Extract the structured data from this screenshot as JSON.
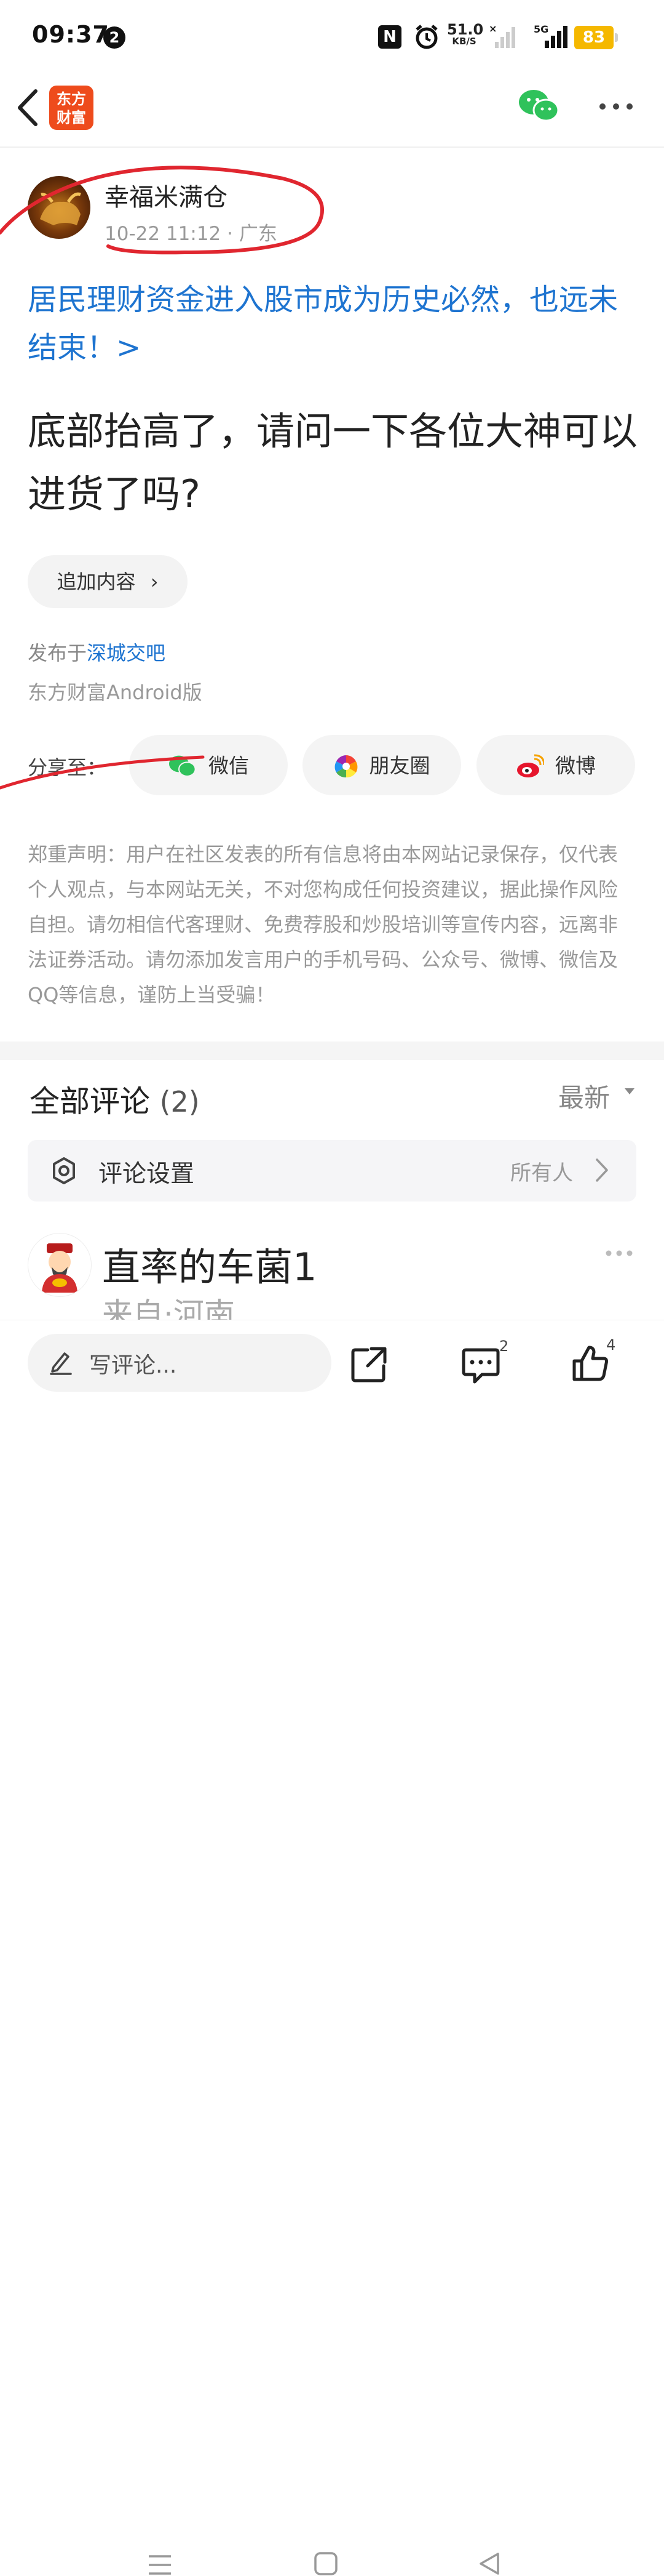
{
  "status_bar": {
    "time": "09:37",
    "notification_count": "2",
    "nfc": "N",
    "net_speed": "51.0",
    "net_speed_unit": "KB/S",
    "network_type": "5G",
    "battery": "83",
    "icons": [
      "nfc-icon",
      "alarm-icon",
      "wifi-off-signal-icon",
      "cell-signal-icon",
      "battery-icon"
    ]
  },
  "nav": {
    "logo_line1": "东方",
    "logo_line2": "财富",
    "icons": [
      "back-icon",
      "wechat-icon",
      "more-icon"
    ]
  },
  "post": {
    "author": "幸福米满仓",
    "meta": "10-22 11:12 · 广东",
    "topic": "居民理财资金进入股市成为历史必然，也远未结束！>",
    "title": "底部抬高了，请问一下各位大神可以进货了吗?",
    "append_label": "追加内容",
    "published_prefix": "发布于",
    "published_bar": "深城交吧",
    "client": "东方财富Android版",
    "share_label": "分享至：",
    "share_wechat": "微信",
    "share_moments": "朋友圈",
    "share_weibo": "微博",
    "disclaimer": "郑重声明：用户在社区发表的所有信息将由本网站记录保存，仅代表个人观点，与本网站无关，不对您构成任何投资建议，据此操作风险自担。请勿相信代客理财、免费荐股和炒股培训等宣传内容，远离非法证券活动。请勿添加发言用户的手机号码、公众号、微博、微信及QQ等信息，谨防上当受骗！"
  },
  "comments": {
    "title": "全部评论",
    "count": "(2)",
    "sort": "最新",
    "settings_label": "评论设置",
    "settings_value": "所有人",
    "first": {
      "name": "直率的车菌1",
      "location": "来自·河南"
    }
  },
  "bottom_bar": {
    "write_placeholder": "写评论...",
    "comment_count": "2",
    "like_count": "4"
  },
  "colors": {
    "link": "#1e74d0",
    "annotation": "#e0262f",
    "battery": "#f5b800",
    "logo": "#ee4b1c"
  }
}
